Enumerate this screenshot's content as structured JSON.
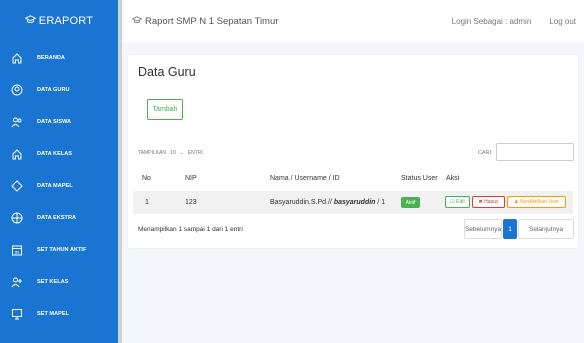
{
  "sidebar": {
    "brand": "ERAPORT",
    "items": [
      {
        "label": "BERANDA",
        "icon": "home-icon"
      },
      {
        "label": "DATA GURU",
        "icon": "user-circle-icon"
      },
      {
        "label": "DATA SISWA",
        "icon": "users-icon"
      },
      {
        "label": "DATA KELAS",
        "icon": "home-icon"
      },
      {
        "label": "DATA MAPEL",
        "icon": "diamond-icon"
      },
      {
        "label": "DATA EKSTRA",
        "icon": "target-icon"
      },
      {
        "label": "SET TAHUN AKTIF",
        "icon": "calendar-icon"
      },
      {
        "label": "SET KELAS",
        "icon": "user-plus-icon"
      },
      {
        "label": "SET MAPEL",
        "icon": "monitor-icon"
      }
    ]
  },
  "topbar": {
    "title": "Raport SMP N 1 Sepatan Timur",
    "login": "Login Sebagai : admin",
    "logout": "Log out"
  },
  "card": {
    "title": "Data Guru",
    "add_label": "Tambah",
    "show_label": "TAMPILKAN",
    "show_value": "10",
    "entries_label": "ENTRI",
    "search_label": "CARI:",
    "columns": [
      "No",
      "NIP",
      "Nama / Username / ID",
      "Status User",
      "Aksi"
    ],
    "rows": [
      {
        "no": "1",
        "nip": "123",
        "nama": "Basyaruddin.S.Pd.//",
        "username": "basyaruddin",
        "id": "/ 1",
        "status": "Aktif"
      }
    ],
    "actions": {
      "edit": "Edit",
      "hapus": "Hapus",
      "nonaktif": "NonAktifkan User"
    },
    "info": "Menampilkan 1 sampai 1 dari 1 entri",
    "pagination": {
      "prev": "Sebelumnya",
      "current": "1",
      "next": "Selanjutnya"
    }
  },
  "colors": {
    "primary": "#1a74d2",
    "success": "#4caf50",
    "danger": "#e53935",
    "warning": "#ff9800"
  }
}
